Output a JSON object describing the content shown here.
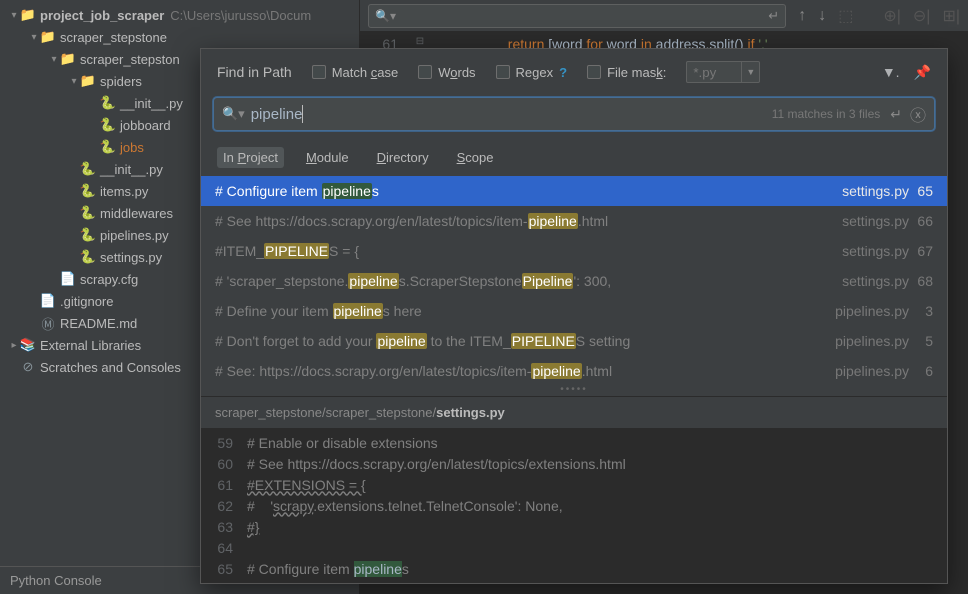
{
  "project": {
    "name": "project_job_scraper",
    "path": "C:\\Users\\jurusso\\Docum"
  },
  "tree": [
    {
      "indent": 0,
      "arrow": "▾",
      "icon": "folder",
      "label": "project_job_scraper",
      "bold": true,
      "path": "C:\\Users\\jurusso\\Docum"
    },
    {
      "indent": 1,
      "arrow": "▾",
      "icon": "folder",
      "label": "scraper_stepstone"
    },
    {
      "indent": 2,
      "arrow": "▾",
      "icon": "folder",
      "label": "scraper_stepston"
    },
    {
      "indent": 3,
      "arrow": "▾",
      "icon": "folder",
      "label": "spiders"
    },
    {
      "indent": 4,
      "arrow": "",
      "icon": "py",
      "label": "__init__.py"
    },
    {
      "indent": 4,
      "arrow": "",
      "icon": "py",
      "label": "jobboard"
    },
    {
      "indent": 4,
      "arrow": "",
      "icon": "py",
      "label": "jobs",
      "highlighted": true
    },
    {
      "indent": 3,
      "arrow": "",
      "icon": "py",
      "label": "__init__.py"
    },
    {
      "indent": 3,
      "arrow": "",
      "icon": "py",
      "label": "items.py"
    },
    {
      "indent": 3,
      "arrow": "",
      "icon": "py",
      "label": "middlewares"
    },
    {
      "indent": 3,
      "arrow": "",
      "icon": "py",
      "label": "pipelines.py"
    },
    {
      "indent": 3,
      "arrow": "",
      "icon": "py",
      "label": "settings.py"
    },
    {
      "indent": 2,
      "arrow": "",
      "icon": "file",
      "label": "scrapy.cfg"
    },
    {
      "indent": 1,
      "arrow": "",
      "icon": "file",
      "label": ".gitignore"
    },
    {
      "indent": 1,
      "arrow": "",
      "icon": "md",
      "label": "README.md"
    },
    {
      "indent": 0,
      "arrow": "▸",
      "icon": "lib",
      "label": "External Libraries"
    },
    {
      "indent": 0,
      "arrow": "",
      "icon": "scratch",
      "label": "Scratches and Consoles"
    }
  ],
  "bottomPanel": "Python Console",
  "editorTop": {
    "lineNum": "61",
    "code_pre": "return",
    "code_mid": " [word ",
    "code_for": "for",
    "code_mid2": " word ",
    "code_in": "in",
    "code_mid3": " address.split() ",
    "code_if": "if",
    "code_end": " ','"
  },
  "findInPath": {
    "title": "Find in Path",
    "matchCase": "Match case",
    "words": "Words",
    "regex": "Regex",
    "fileMask": "File mask:",
    "fileMaskValue": "*.py",
    "searchValue": "pipeline",
    "matchInfo": "11 matches in 3 files",
    "tabs": {
      "project": "In Project",
      "module": "Module",
      "directory": "Directory",
      "scope": "Scope"
    },
    "results": [
      {
        "pre": "# Configure item ",
        "hl": [
          "pipeline"
        ],
        "after": [
          "s"
        ],
        "file": "settings.py",
        "line": "65",
        "selected": true
      },
      {
        "pre": "# See https://docs.scrapy.org/en/latest/topics/item-",
        "hl": [
          "pipeline"
        ],
        "after": [
          ".html"
        ],
        "file": "settings.py",
        "line": "66"
      },
      {
        "pre": "#ITEM_",
        "hl": [
          "PIPELINE"
        ],
        "after": [
          "S = {"
        ],
        "file": "settings.py",
        "line": "67"
      },
      {
        "pre": "#    'scraper_stepstone.",
        "hl": [
          "pipeline",
          "Pipeline"
        ],
        "mid": [
          "s.ScraperStepstone"
        ],
        "after": [
          "': 300,"
        ],
        "file": "settings.py",
        "line": "68"
      },
      {
        "pre": "# Define your item ",
        "hl": [
          "pipeline"
        ],
        "after": [
          "s here"
        ],
        "file": "pipelines.py",
        "line": "3"
      },
      {
        "pre": "# Don't forget to add your ",
        "hl": [
          "pipeline",
          "PIPELINE"
        ],
        "mid": [
          " to the ITEM_"
        ],
        "after": [
          "S setting"
        ],
        "file": "pipelines.py",
        "line": "5"
      },
      {
        "pre": "# See: https://docs.scrapy.org/en/latest/topics/item-",
        "hl": [
          "pipeline"
        ],
        "after": [
          ".html"
        ],
        "file": "pipelines.py",
        "line": "6"
      }
    ],
    "previewPath": {
      "pre": "scraper_stepstone/scraper_stepstone/",
      "file": "settings.py"
    },
    "preview": [
      {
        "num": "59",
        "code": "# Enable or disable extensions"
      },
      {
        "num": "60",
        "code": "# See https://docs.scrapy.org/en/latest/topics/extensions.html"
      },
      {
        "num": "61",
        "wavy": "#EXTENSIONS = {"
      },
      {
        "num": "62",
        "code": "#    '",
        "wavy2": "scrapy",
        "code2": ".extensions.telnet.TelnetConsole': None,"
      },
      {
        "num": "63",
        "wavy": "#}"
      },
      {
        "num": "64",
        "code": ""
      },
      {
        "num": "65",
        "code": "# Configure item ",
        "hlcode": "pipeline",
        "code2": "s",
        "current": true
      }
    ]
  }
}
